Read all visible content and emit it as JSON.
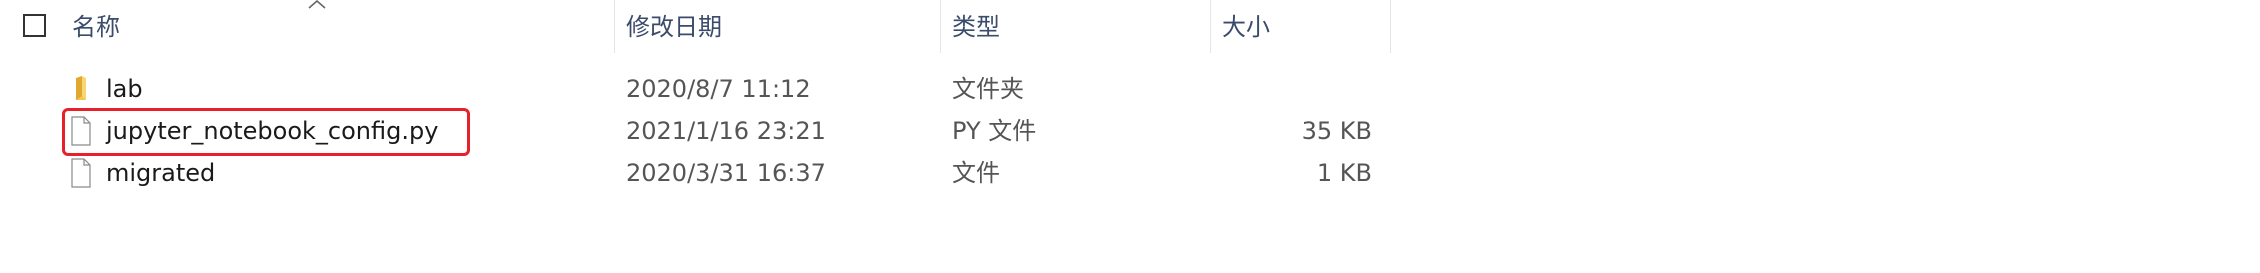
{
  "header": {
    "columns": {
      "name": "名称",
      "date_modified": "修改日期",
      "type": "类型",
      "size": "大小"
    }
  },
  "files": [
    {
      "name": "lab",
      "date_modified": "2020/8/7 11:12",
      "type": "文件夹",
      "size": "",
      "icon": "folder-icon"
    },
    {
      "name": "jupyter_notebook_config.py",
      "date_modified": "2021/1/16 23:21",
      "type": "PY 文件",
      "size": "35 KB",
      "icon": "file-icon",
      "highlighted": true
    },
    {
      "name": "migrated",
      "date_modified": "2020/3/31 16:37",
      "type": "文件",
      "size": "1 KB",
      "icon": "file-icon"
    }
  ],
  "colors": {
    "header_text": "#3b4b6b",
    "folder": "#f2c94c",
    "highlight": "#e8202a"
  }
}
